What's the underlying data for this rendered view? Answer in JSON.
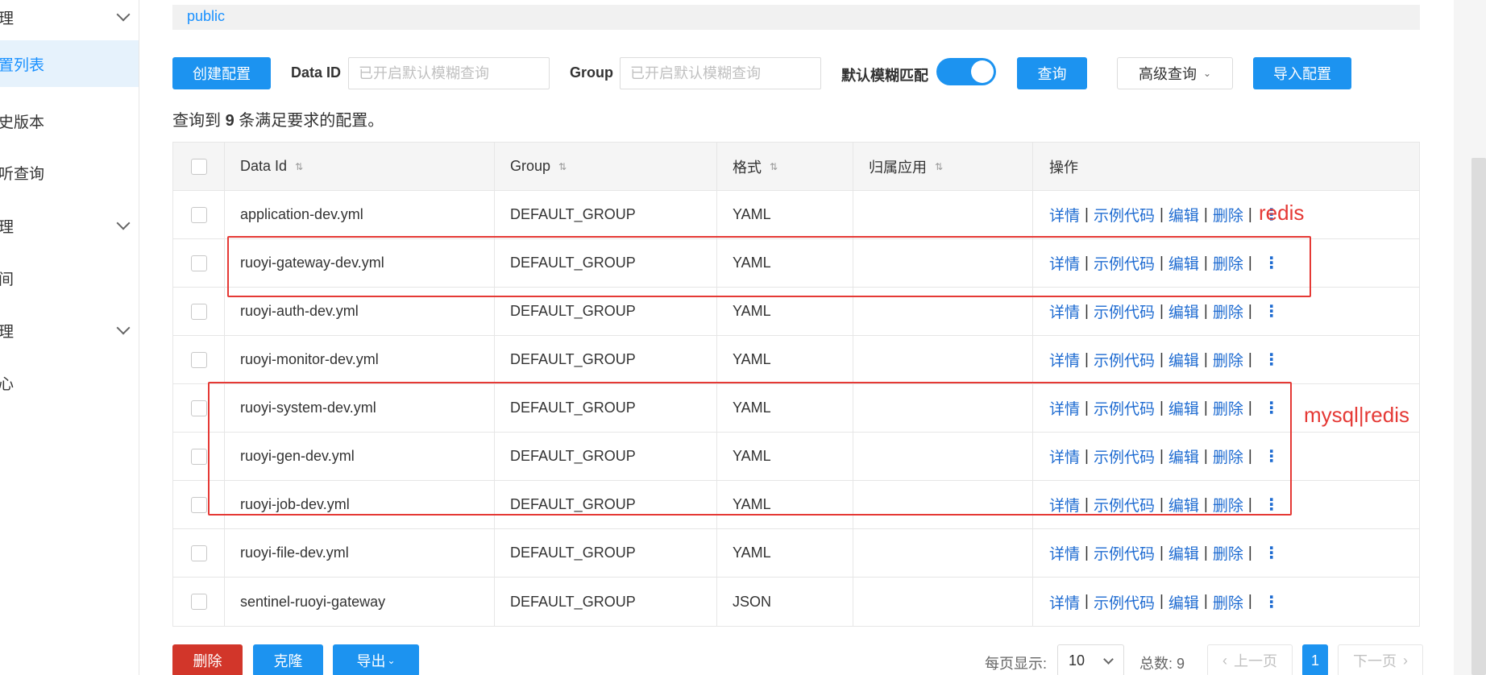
{
  "sidebar": {
    "items": [
      {
        "label": "理",
        "has_chevron": true
      },
      {
        "label": "置列表",
        "active": true
      },
      {
        "label": "史版本"
      },
      {
        "label": "听查询"
      },
      {
        "label": "理",
        "has_chevron": true
      },
      {
        "label": "间"
      },
      {
        "label": "理",
        "has_chevron": true
      },
      {
        "label": "心"
      }
    ]
  },
  "namespace": {
    "label": "public"
  },
  "toolbar": {
    "create_label": "创建配置",
    "data_id_label": "Data ID",
    "data_id_placeholder": "已开启默认模糊查询",
    "group_label": "Group",
    "group_placeholder": "已开启默认模糊查询",
    "fuzzy_label": "默认模糊匹配",
    "fuzzy_enabled": true,
    "query_label": "查询",
    "advanced_label": "高级查询",
    "import_label": "导入配置"
  },
  "result": {
    "prefix": "查询到",
    "count": "9",
    "suffix": "条满足要求的配置。"
  },
  "table": {
    "headers": {
      "data_id": "Data Id",
      "group": "Group",
      "format": "格式",
      "app": "归属应用",
      "ops": "操作"
    },
    "ops_labels": {
      "detail": "详情",
      "sample": "示例代码",
      "edit": "编辑",
      "delete": "删除"
    },
    "rows": [
      {
        "data_id": "application-dev.yml",
        "group": "DEFAULT_GROUP",
        "format": "YAML",
        "app": ""
      },
      {
        "data_id": "ruoyi-gateway-dev.yml",
        "group": "DEFAULT_GROUP",
        "format": "YAML",
        "app": ""
      },
      {
        "data_id": "ruoyi-auth-dev.yml",
        "group": "DEFAULT_GROUP",
        "format": "YAML",
        "app": ""
      },
      {
        "data_id": "ruoyi-monitor-dev.yml",
        "group": "DEFAULT_GROUP",
        "format": "YAML",
        "app": ""
      },
      {
        "data_id": "ruoyi-system-dev.yml",
        "group": "DEFAULT_GROUP",
        "format": "YAML",
        "app": ""
      },
      {
        "data_id": "ruoyi-gen-dev.yml",
        "group": "DEFAULT_GROUP",
        "format": "YAML",
        "app": ""
      },
      {
        "data_id": "ruoyi-job-dev.yml",
        "group": "DEFAULT_GROUP",
        "format": "YAML",
        "app": ""
      },
      {
        "data_id": "ruoyi-file-dev.yml",
        "group": "DEFAULT_GROUP",
        "format": "YAML",
        "app": ""
      },
      {
        "data_id": "sentinel-ruoyi-gateway",
        "group": "DEFAULT_GROUP",
        "format": "JSON",
        "app": ""
      }
    ]
  },
  "annotations": {
    "redis_label": "redis",
    "mysql_redis_label": "mysql|redis",
    "color": "#e53935"
  },
  "bottom": {
    "delete_label": "删除",
    "clone_label": "克隆",
    "export_label": "导出",
    "page_size_label": "每页显示:",
    "page_size_value": "10",
    "total_label": "总数: 9",
    "prev_label": "上一页",
    "page_current": "1",
    "next_label": "下一页"
  },
  "colors": {
    "primary": "#1c93f0",
    "danger": "#d2362a",
    "link": "#1e6bd1"
  }
}
